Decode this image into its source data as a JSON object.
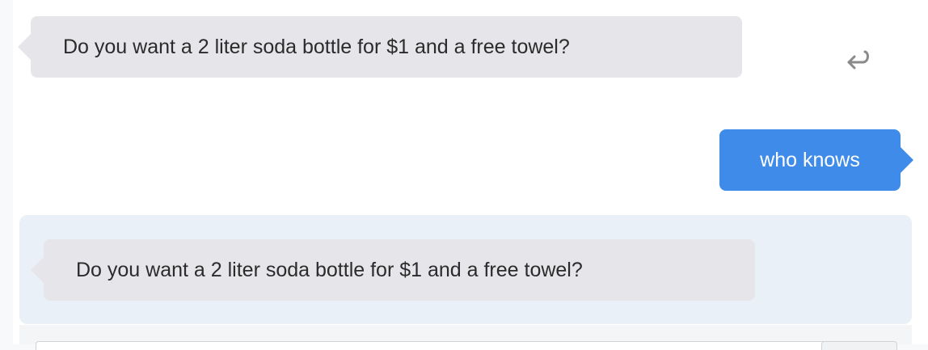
{
  "messages": [
    {
      "sender": "bot",
      "text": "Do you want a 2 liter soda bottle for $1 and a free towel?"
    },
    {
      "sender": "user",
      "text": "who knows"
    },
    {
      "sender": "bot",
      "text": "Do you want a 2 liter soda bottle for $1 and a free towel?",
      "highlighted": true
    }
  ],
  "icons": {
    "reply": "reply-arrow-icon"
  },
  "colors": {
    "bot_bubble": "#e6e6ea",
    "user_bubble": "#3f8bea",
    "highlight_background": "#e9f0f8",
    "icon": "#8a8a8a"
  }
}
